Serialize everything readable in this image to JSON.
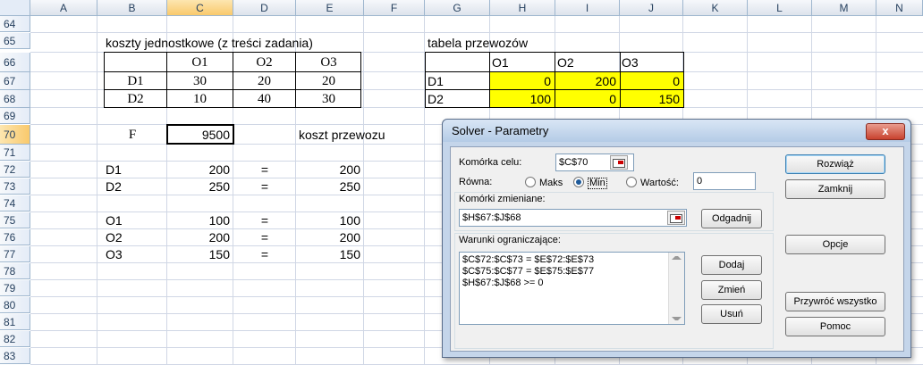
{
  "columns": [
    "A",
    "B",
    "C",
    "D",
    "E",
    "F",
    "G",
    "H",
    "I",
    "J",
    "K",
    "L",
    "M",
    "N"
  ],
  "rows": [
    "64",
    "65",
    "66",
    "67",
    "68",
    "69",
    "70",
    "71",
    "72",
    "73",
    "74",
    "75",
    "76",
    "77",
    "78",
    "79",
    "80",
    "81",
    "82",
    "83"
  ],
  "selected": {
    "column": "C",
    "row": "70"
  },
  "left_table": {
    "title": "koszty jednostkowe (z treści zadania)",
    "headers": [
      "O1",
      "O2",
      "O3"
    ],
    "rows": [
      {
        "label": "D1",
        "values": [
          "30",
          "20",
          "20"
        ]
      },
      {
        "label": "D2",
        "values": [
          "10",
          "40",
          "30"
        ]
      }
    ]
  },
  "right_table": {
    "title": "tabela przewozów",
    "headers": [
      "O1",
      "O2",
      "O3"
    ],
    "rows": [
      {
        "label": "D1",
        "values": [
          "0",
          "200",
          "0"
        ]
      },
      {
        "label": "D2",
        "values": [
          "100",
          "0",
          "150"
        ]
      }
    ]
  },
  "objective": {
    "label": "F",
    "value": "9500",
    "caption": "koszt przewozu"
  },
  "constraints": [
    {
      "label": "D1",
      "value": "200",
      "eq": "=",
      "rhs": "200"
    },
    {
      "label": "D2",
      "value": "250",
      "eq": "=",
      "rhs": "250"
    },
    {
      "label": "O1",
      "value": "100",
      "eq": "=",
      "rhs": "100"
    },
    {
      "label": "O2",
      "value": "200",
      "eq": "=",
      "rhs": "200"
    },
    {
      "label": "O3",
      "value": "150",
      "eq": "=",
      "rhs": "150"
    }
  ],
  "dialog": {
    "title": "Solver - Parametry",
    "close": "x",
    "target_label": "Komórka celu:",
    "target_value": "$C$70",
    "equal_label": "Równa:",
    "opt_max": "Maks",
    "opt_min": "Min",
    "opt_value": "Wartość:",
    "value_field": "0",
    "changing_label": "Komórki zmieniane:",
    "changing_value": "$H$67:$J$68",
    "guess": "Odgadnij",
    "constraints_label": "Warunki ograniczające:",
    "constraints_list": [
      "$C$72:$C$73 = $E$72:$E$73",
      "$C$75:$C$77 = $E$75:$E$77",
      "$H$67:$J$68 >= 0"
    ],
    "add": "Dodaj",
    "change": "Zmień",
    "delete": "Usuń",
    "solve": "Rozwiąż",
    "close_btn": "Zamknij",
    "options": "Opcje",
    "reset": "Przywróć wszystko",
    "help": "Pomoc"
  }
}
